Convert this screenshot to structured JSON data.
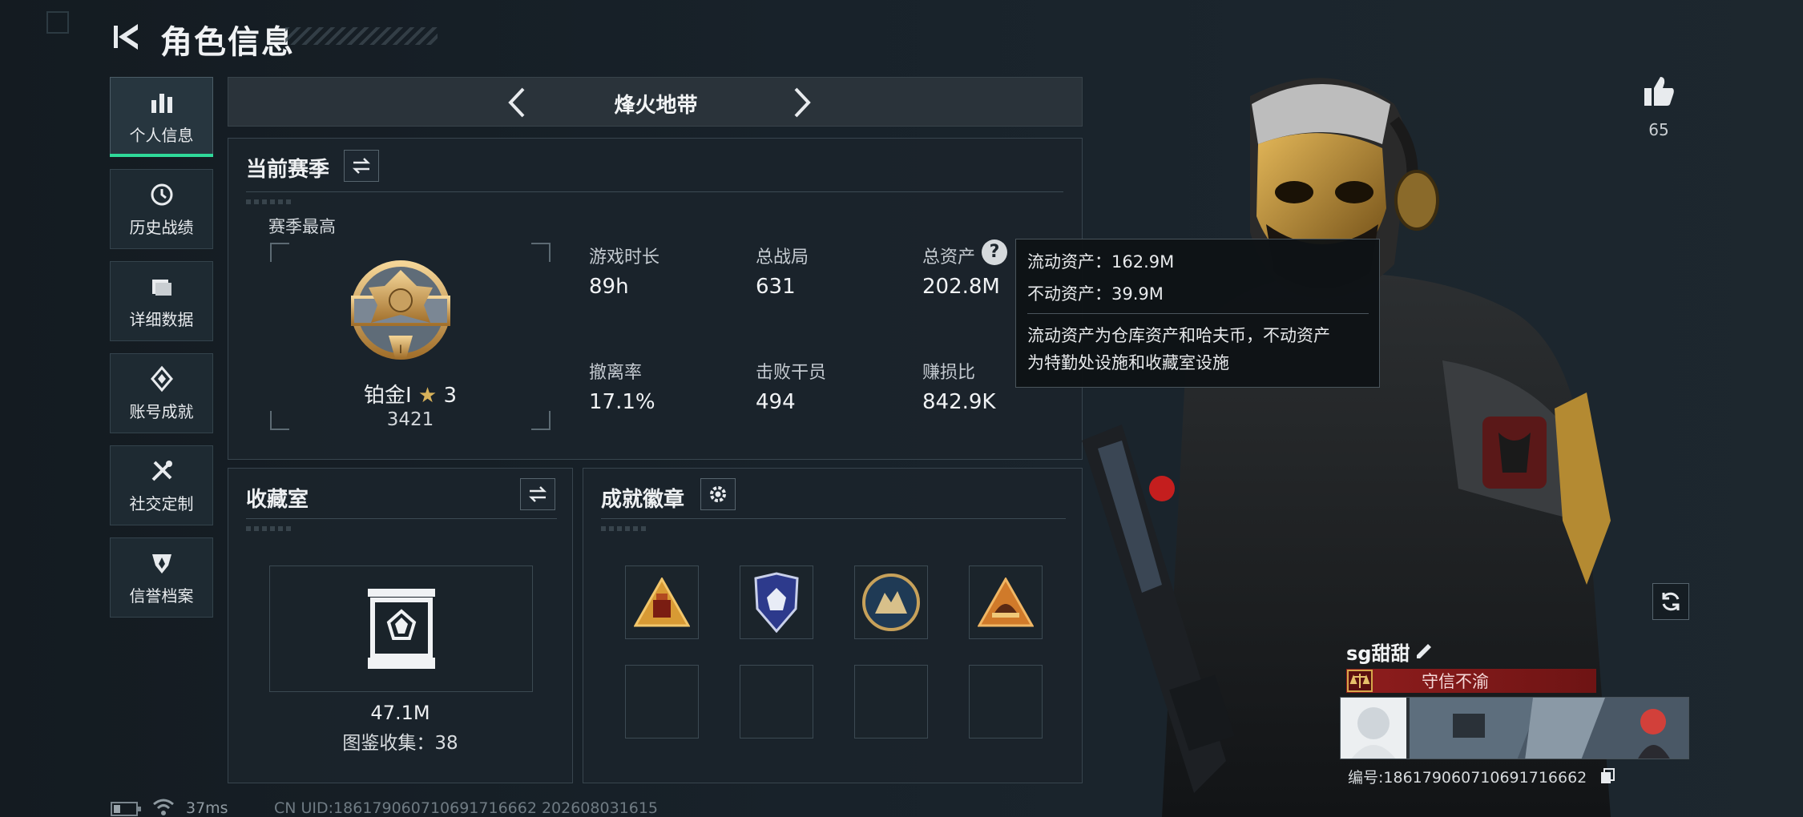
{
  "header": {
    "title": "角色信息"
  },
  "sidebar": {
    "items": [
      {
        "label": "个人信息",
        "icon": "bar-chart-icon",
        "active": true
      },
      {
        "label": "历史战绩",
        "icon": "history-clock-icon",
        "active": false
      },
      {
        "label": "详细数据",
        "icon": "folder-icon",
        "active": false
      },
      {
        "label": "账号成就",
        "icon": "achievement-diamond-icon",
        "active": false
      },
      {
        "label": "社交定制",
        "icon": "tools-icon",
        "active": false
      },
      {
        "label": "信誉档案",
        "icon": "reputation-shield-icon",
        "active": false
      }
    ]
  },
  "mode": {
    "label": "烽火地带"
  },
  "season": {
    "title": "当前赛季",
    "best_label": "赛季最高",
    "rank_name": "铂金Ⅰ",
    "rank_stars": "3",
    "rank_points": "3421",
    "stats": [
      {
        "label": "游戏时长",
        "value": "89h"
      },
      {
        "label": "总战局",
        "value": "631"
      },
      {
        "label": "总资产",
        "value": "202.8M"
      },
      {
        "label": "撤离率",
        "value": "17.1%"
      },
      {
        "label": "击败干员",
        "value": "494"
      },
      {
        "label": "赚损比",
        "value": "842.9K"
      }
    ]
  },
  "tooltip": {
    "liquid": "流动资产：162.9M",
    "fixed": "不动资产：39.9M",
    "desc_line1": "流动资产为仓库资产和哈夫币，不动资产",
    "desc_line2": "为特勤处设施和收藏室设施"
  },
  "collection": {
    "title": "收藏室",
    "value": "47.1M",
    "count_text": "图鉴收集：38"
  },
  "badges": {
    "title": "成就徽章"
  },
  "player": {
    "likes": "65",
    "name": "sg甜甜",
    "title_badge": "守信不渝",
    "id_text": "编号:1861790607106917166​62"
  },
  "status": {
    "ping": "37ms",
    "uid": "CN UID:18617906071069171666​2 202608031615"
  },
  "colors": {
    "accent": "#2fd99a",
    "title_red": "#8f1d1d",
    "gold": "#c79a3c"
  }
}
